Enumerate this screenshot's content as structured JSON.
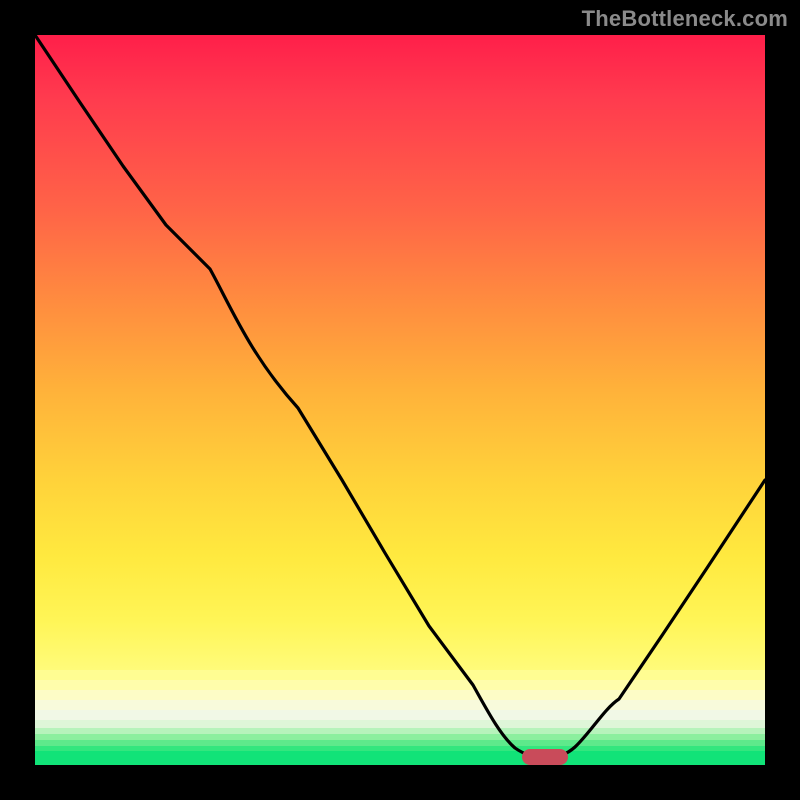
{
  "watermark": "TheBottleneck.com",
  "colors": {
    "accent_marker": "#c94b5a",
    "curve": "#000000",
    "gradient_top": "#ff1f4a",
    "gradient_mid": "#ffd23a",
    "gradient_low": "#fffb7a",
    "green_base": "#11e378"
  },
  "chart_data": {
    "type": "line",
    "title": "",
    "xlabel": "",
    "ylabel": "",
    "xlim": [
      0,
      100
    ],
    "ylim": [
      0,
      100
    ],
    "grid": false,
    "legend": false,
    "note": "Axes are unlabeled in the image; values are normalized 0–100. Background is a heat gradient from red (top / high mismatch) to green (bottom / ideal).",
    "series": [
      {
        "name": "bottleneck-curve",
        "x": [
          0,
          6,
          12,
          18,
          24,
          30,
          36,
          42,
          48,
          54,
          60,
          64,
          68,
          70,
          72,
          76,
          80,
          86,
          92,
          100
        ],
        "y": [
          100,
          91,
          82,
          74,
          68,
          59,
          49,
          39,
          29,
          19,
          11,
          5,
          2,
          1,
          1,
          3,
          9,
          18,
          27,
          39
        ]
      }
    ],
    "marker": {
      "name": "optimal-point",
      "x_range": [
        67,
        73
      ],
      "y": 1,
      "shape": "pill"
    },
    "axes_visible": true
  }
}
